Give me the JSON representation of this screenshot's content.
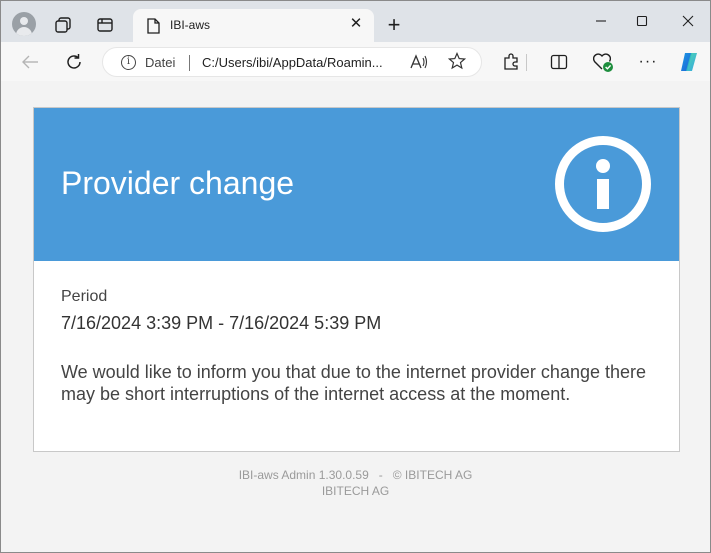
{
  "browser": {
    "tab_title": "IBI-aws",
    "address_label": "Datei",
    "address_url": "C:/Users/ibi/AppData/Roamin...",
    "read_aloud_label": "Aͅ",
    "icons": [
      "profile-icon",
      "collections-icon",
      "tab-actions-icon",
      "page-icon",
      "close-icon",
      "new-tab-icon",
      "minimize-icon",
      "maximize-icon",
      "window-close-icon",
      "back-icon",
      "refresh-icon",
      "info-icon",
      "read-aloud-icon",
      "favorite-icon",
      "extensions-icon",
      "split-screen-icon",
      "browser-essentials-icon",
      "more-icon",
      "copilot-icon"
    ]
  },
  "notice": {
    "title": "Provider change",
    "period_label": "Period",
    "period_value": "7/16/2024 3:39 PM - 7/16/2024 5:39 PM",
    "message": "We would like to inform you that due to the internet provider change there may be short interruptions of the internet access at the moment.",
    "header_color": "#4a9ad9"
  },
  "footer": {
    "line1": "IBI-aws Admin 1.30.0.59   -   © IBITECH AG",
    "line2": "IBITECH AG"
  }
}
